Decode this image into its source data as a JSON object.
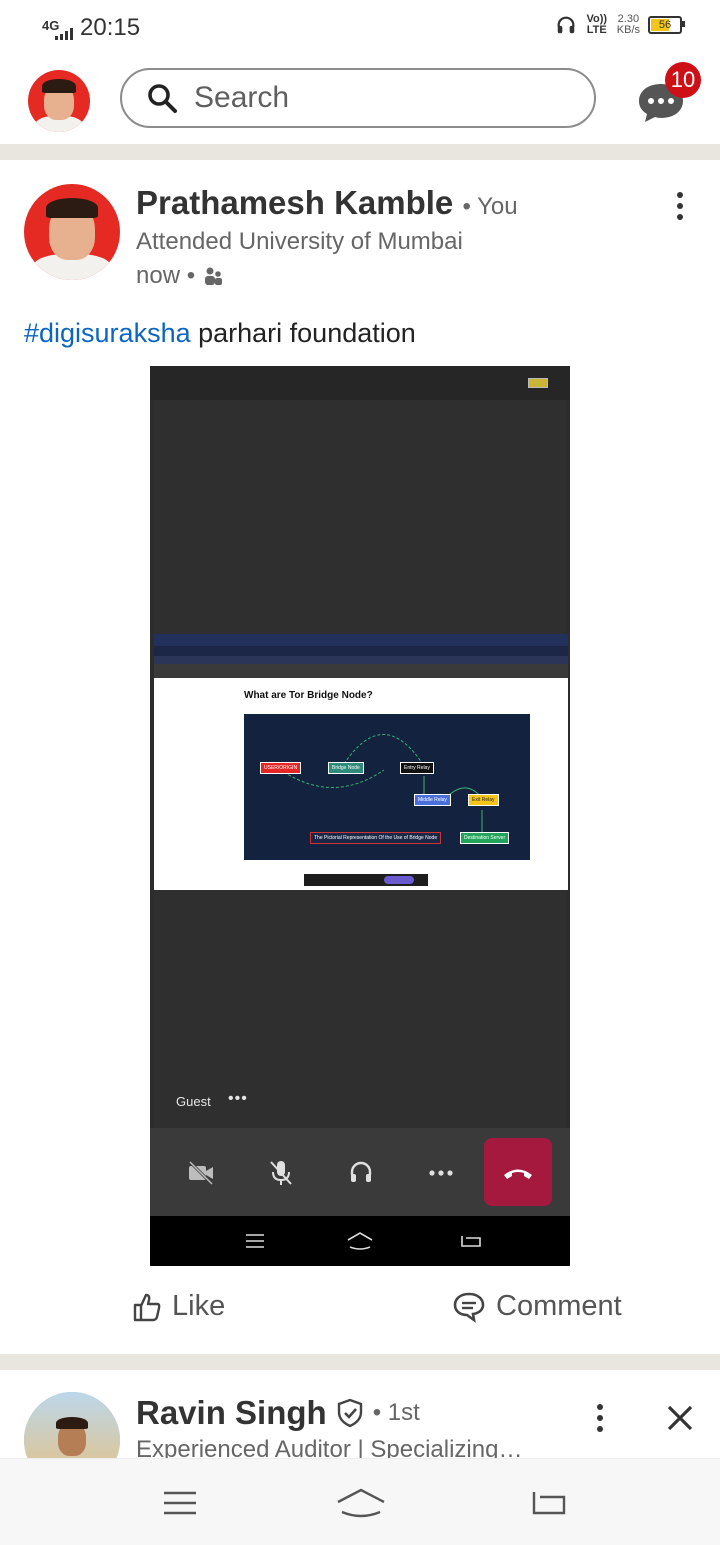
{
  "status_bar": {
    "network": "4G",
    "time": "20:15",
    "volte": "Vo)) LTE",
    "speed_value": "2.30",
    "speed_unit": "KB/s",
    "battery": "56"
  },
  "header": {
    "search_placeholder": "Search",
    "messages_badge": "10"
  },
  "post": {
    "author": "Prathamesh Kamble",
    "author_suffix": "• You",
    "headline": "Attended University of Mumbai",
    "time": "now •",
    "hashtag": "#digisuraksha",
    "text_rest": " parhari foundation",
    "embedded": {
      "slide_title": "What are Tor Bridge Node?",
      "nodes": [
        "USER/ORIGIN",
        "Bridge Node",
        "Entry Relay",
        "Middle Relay",
        "Exit Relay",
        "Destination Server"
      ],
      "caption": "The Pictorial Representation Of the Use of Bridge Node",
      "participant": "Guest",
      "participant_more": "•••"
    }
  },
  "actions": {
    "like": "Like",
    "comment": "Comment"
  },
  "next_post": {
    "author": "Ravin Singh",
    "degree": "• 1st",
    "headline": "Experienced Auditor | Specializing…"
  }
}
